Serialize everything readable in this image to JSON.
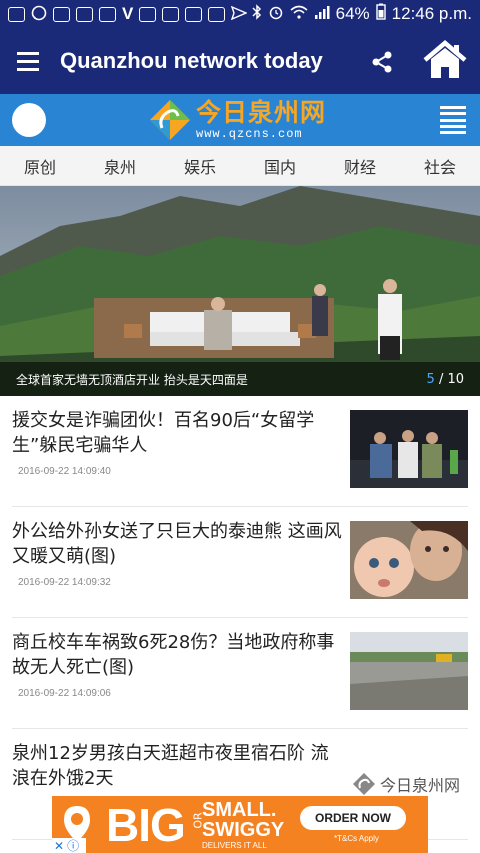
{
  "status_bar": {
    "icons": [
      "notification-icon",
      "whatsapp-icon",
      "gallery-icon",
      "image-icon",
      "mail-icon",
      "v-icon",
      "deer-icon",
      "deer-icon",
      "deer-icon",
      "mail-icon",
      "send-icon"
    ],
    "battery": "64%",
    "time": "12:46 p.m."
  },
  "app_bar": {
    "title": "Quanzhou network today"
  },
  "brand": {
    "logo_cn": "今日泉州网",
    "logo_url": "www.qzcns.com"
  },
  "tabs": [
    "原创",
    "泉州",
    "娱乐",
    "国内",
    "财经",
    "社会"
  ],
  "hero": {
    "caption": "全球首家无墙无顶酒店开业 抬头是天四面是",
    "current": "5",
    "total": "/ 10"
  },
  "news": [
    {
      "title": "援交女是诈骗团伙！百名90后“女留学生”躲民宅骗华人",
      "time": "2016-09-22 14:09:40"
    },
    {
      "title": "外公给外孙女送了只巨大的泰迪熊 这画风又暖又萌(图)",
      "time": "2016-09-22 14:09:32"
    },
    {
      "title": "商丘校车车祸致6死28伤？当地政府称事故无人死亡(图)",
      "time": "2016-09-22 14:09:06"
    },
    {
      "title": "泉州12岁男孩白天逛超市夜里宿石阶 流浪在外饿2天",
      "time": ""
    }
  ],
  "watermark": "今日泉州网",
  "ad": {
    "big": "BIG",
    "or": "OR",
    "small": "SMALL.",
    "swiggy": "SWIGGY",
    "delivers": "DELIVERS IT ALL",
    "order_button": "ORDER NOW",
    "tc": "*T&Cs Apply"
  },
  "colors": {
    "app_bar": "#1b2a78",
    "brand_bar": "#2a84d4",
    "logo_orange": "#f6a623",
    "counter_blue": "#4aa8ff",
    "ad_orange": "#f58220"
  }
}
